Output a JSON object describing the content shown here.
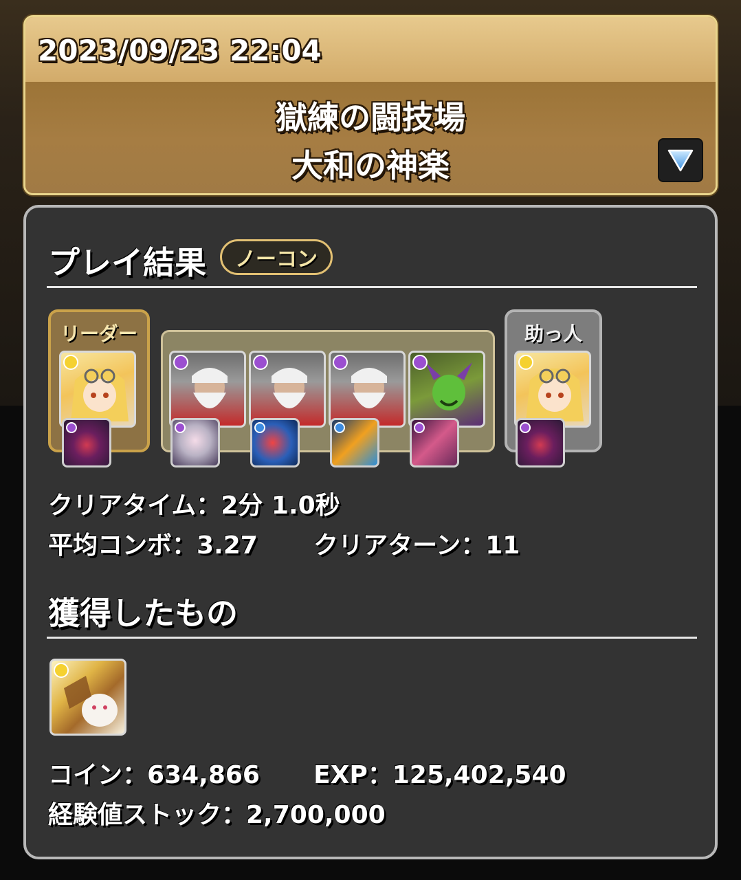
{
  "header": {
    "datetime": "2023/09/23 22:04",
    "dungeon_line1": "獄練の闘技場",
    "dungeon_line2": "大和の神楽",
    "expand_icon": "triangle-down-icon"
  },
  "result": {
    "title": "プレイ結果",
    "badge": "ノーコン",
    "leader_label": "リーダー",
    "helper_label": "助っ人",
    "team": {
      "leader": {
        "attribute": "light",
        "assist_attribute": "dark"
      },
      "subs": [
        {
          "attribute": "dark",
          "assist_attribute": "dark"
        },
        {
          "attribute": "dark",
          "assist_attribute": "water"
        },
        {
          "attribute": "dark",
          "assist_attribute": "water"
        },
        {
          "attribute": "dark",
          "assist_attribute": "dark"
        }
      ],
      "helper": {
        "attribute": "light",
        "assist_attribute": "dark"
      }
    },
    "clear_time": "クリアタイム：2分 1.0秒",
    "avg_combo": "平均コンボ：3.27",
    "clear_turns": "クリアターン：11"
  },
  "loot": {
    "title": "獲得したもの",
    "item_attribute": "light",
    "coins": "コイン：634,866",
    "exp": "EXP：125,402,540",
    "exp_stock": "経験値ストック：2,700,000"
  },
  "colors": {
    "light": "#f5d130",
    "dark": "#9b4fd0",
    "water": "#3d8be0",
    "gold_border": "#e9d58c"
  }
}
